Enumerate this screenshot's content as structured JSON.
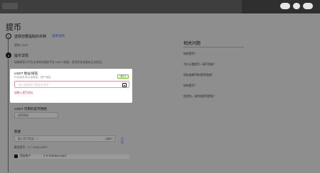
{
  "page": {
    "title": "提币"
  },
  "steps": {
    "select_coin": {
      "number": "1",
      "label": "选择您要提取的币种",
      "link": "查看视频",
      "sub": "提取 USDT"
    },
    "withdraw_details": {
      "number": "2",
      "label": "提币详情",
      "description": "请确保您与平台支持您的接收平台 USDT 网络，否则资金或遗失无法找回。"
    }
  },
  "address_card": {
    "title": "USDT 地址/域名",
    "description": "只支持去中心化钱包、资产地址",
    "badge": "热门",
    "placeholder": "输入或粘贴已填地址/域名",
    "error": "请输入提币地址"
  },
  "network": {
    "title": "USDT 可用的提币网络",
    "select_text": "选择网络"
  },
  "quantity": {
    "title": "数量",
    "placeholder": "最小提币数量：2",
    "unit": "USDT",
    "all_label": "全部",
    "minimum": "最低提币：0.7 TUSD USDT"
  },
  "bottom": {
    "label": "资金账户",
    "value": "2.7FGREBM USDT"
  },
  "faq": {
    "title": "相关问题",
    "items": [
      "如何提币？",
      "为什么我提币一直不到账？",
      "如何选择币种/提币网络？",
      "如何提币？",
      "危险的，如何加密币提现？"
    ]
  },
  "colors": {
    "background": "#8e8e8e",
    "accent_link": "#2f4a8a",
    "success_badge": "#e5f6d3",
    "error": "#d24a57"
  }
}
